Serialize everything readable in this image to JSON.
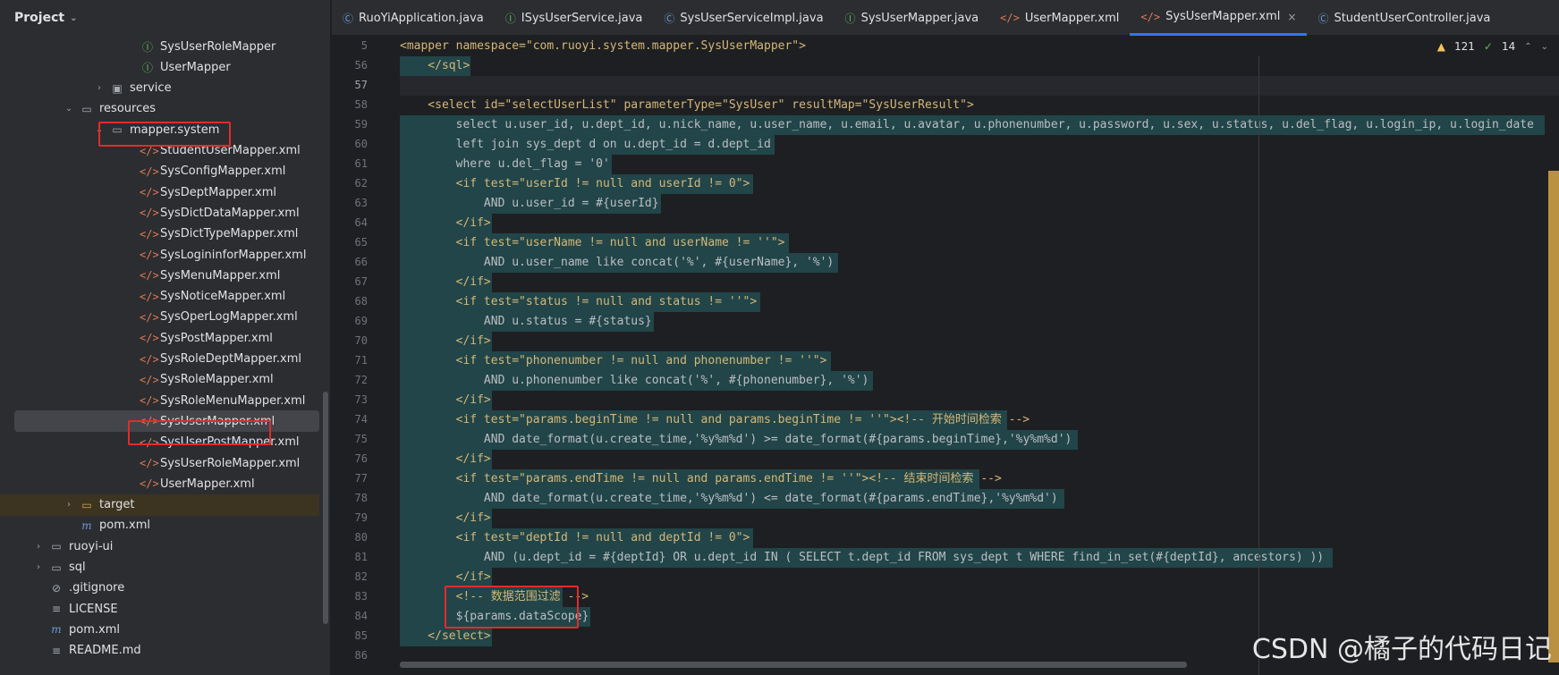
{
  "project": {
    "title": "Project",
    "tree": [
      {
        "label": "SysUserRoleMapper",
        "icon": "interface-icon",
        "indent": 3
      },
      {
        "label": "UserMapper",
        "icon": "interface-icon",
        "indent": 3
      },
      {
        "label": "service",
        "icon": "package-icon",
        "indent": 2,
        "arrow": "›"
      },
      {
        "label": "resources",
        "icon": "folder-icon",
        "indent": 1,
        "arrow": "⌄"
      },
      {
        "label": "mapper.system",
        "icon": "folder-icon",
        "indent": 2,
        "arrow": "⌄"
      },
      {
        "label": "StudentUserMapper.xml",
        "icon": "xml-icon",
        "indent": 3
      },
      {
        "label": "SysConfigMapper.xml",
        "icon": "xml-icon",
        "indent": 3
      },
      {
        "label": "SysDeptMapper.xml",
        "icon": "xml-icon",
        "indent": 3
      },
      {
        "label": "SysDictDataMapper.xml",
        "icon": "xml-icon",
        "indent": 3
      },
      {
        "label": "SysDictTypeMapper.xml",
        "icon": "xml-icon",
        "indent": 3
      },
      {
        "label": "SysLogininforMapper.xml",
        "icon": "xml-icon",
        "indent": 3
      },
      {
        "label": "SysMenuMapper.xml",
        "icon": "xml-icon",
        "indent": 3
      },
      {
        "label": "SysNoticeMapper.xml",
        "icon": "xml-icon",
        "indent": 3
      },
      {
        "label": "SysOperLogMapper.xml",
        "icon": "xml-icon",
        "indent": 3
      },
      {
        "label": "SysPostMapper.xml",
        "icon": "xml-icon",
        "indent": 3
      },
      {
        "label": "SysRoleDeptMapper.xml",
        "icon": "xml-icon",
        "indent": 3
      },
      {
        "label": "SysRoleMapper.xml",
        "icon": "xml-icon",
        "indent": 3
      },
      {
        "label": "SysRoleMenuMapper.xml",
        "icon": "xml-icon",
        "indent": 3
      },
      {
        "label": "SysUserMapper.xml",
        "icon": "xml-icon",
        "indent": 3,
        "selected": true
      },
      {
        "label": "SysUserPostMapper.xml",
        "icon": "xml-icon",
        "indent": 3
      },
      {
        "label": "SysUserRoleMapper.xml",
        "icon": "xml-icon",
        "indent": 3
      },
      {
        "label": "UserMapper.xml",
        "icon": "xml-icon",
        "indent": 3
      },
      {
        "label": "target",
        "icon": "folder-orange-icon",
        "indent": 1,
        "arrow": "›",
        "target": true
      },
      {
        "label": "pom.xml",
        "icon": "maven-icon",
        "indent": 1
      },
      {
        "label": "ruoyi-ui",
        "icon": "folder-icon",
        "indent": 0,
        "arrow": "›"
      },
      {
        "label": "sql",
        "icon": "folder-icon",
        "indent": 0,
        "arrow": "›"
      },
      {
        "label": ".gitignore",
        "icon": "gitignore-icon",
        "indent": 0
      },
      {
        "label": "LICENSE",
        "icon": "text-file-icon",
        "indent": 0
      },
      {
        "label": "pom.xml",
        "icon": "maven-icon",
        "indent": 0
      },
      {
        "label": "README.md",
        "icon": "text-file-icon",
        "indent": 0
      }
    ]
  },
  "tabs": [
    {
      "label": "RuoYiApplication.java",
      "icon": "class-icon"
    },
    {
      "label": "ISysUserService.java",
      "icon": "interface-icon"
    },
    {
      "label": "SysUserServiceImpl.java",
      "icon": "class-icon"
    },
    {
      "label": "SysUserMapper.java",
      "icon": "interface-icon"
    },
    {
      "label": "UserMapper.xml",
      "icon": "xml-icon"
    },
    {
      "label": "SysUserMapper.xml",
      "icon": "xml-icon",
      "active": true
    },
    {
      "label": "StudentUserController.java",
      "icon": "class-icon"
    }
  ],
  "inspections": {
    "warnings": "121",
    "ok": "14"
  },
  "code": [
    {
      "n": "5",
      "text": "<mapper namespace=\"com.ruoyi.system.mapper.SysUserMapper\">"
    },
    {
      "n": "56",
      "text": "    </sql>",
      "sel": true
    },
    {
      "n": "57",
      "text": "",
      "curr": true
    },
    {
      "n": "58",
      "text": "    <select id=\"selectUserList\" parameterType=\"SysUser\" resultMap=\"SysUserResult\">"
    },
    {
      "n": "59",
      "text": "        select u.user_id, u.dept_id, u.nick_name, u.user_name, u.email, u.avatar, u.phonenumber, u.password, u.sex, u.status, u.del_flag, u.login_ip, u.login_date",
      "sel": true
    },
    {
      "n": "60",
      "text": "        left join sys_dept d on u.dept_id = d.dept_id",
      "sel": true
    },
    {
      "n": "61",
      "text": "        where u.del_flag = '0'",
      "sel": true
    },
    {
      "n": "62",
      "text": "        <if test=\"userId != null and userId != 0\">",
      "sel": true
    },
    {
      "n": "63",
      "text": "            AND u.user_id = #{userId}",
      "sel": true
    },
    {
      "n": "64",
      "text": "        </if>",
      "sel": true
    },
    {
      "n": "65",
      "text": "        <if test=\"userName != null and userName != ''\">",
      "sel": true
    },
    {
      "n": "66",
      "text": "            AND u.user_name like concat('%', #{userName}, '%')",
      "sel": true
    },
    {
      "n": "67",
      "text": "        </if>",
      "sel": true
    },
    {
      "n": "68",
      "text": "        <if test=\"status != null and status != ''\">",
      "sel": true
    },
    {
      "n": "69",
      "text": "            AND u.status = #{status}",
      "sel": true
    },
    {
      "n": "70",
      "text": "        </if>",
      "sel": true
    },
    {
      "n": "71",
      "text": "        <if test=\"phonenumber != null and phonenumber != ''\">",
      "sel": true
    },
    {
      "n": "72",
      "text": "            AND u.phonenumber like concat('%', #{phonenumber}, '%')",
      "sel": true
    },
    {
      "n": "73",
      "text": "        </if>",
      "sel": true
    },
    {
      "n": "74",
      "text": "        <if test=\"params.beginTime != null and params.beginTime != ''\"><!-- 开始时间检索 -->",
      "sel": true
    },
    {
      "n": "75",
      "text": "            AND date_format(u.create_time,'%y%m%d') >= date_format(#{params.beginTime},'%y%m%d')",
      "sel": true
    },
    {
      "n": "76",
      "text": "        </if>",
      "sel": true
    },
    {
      "n": "77",
      "text": "        <if test=\"params.endTime != null and params.endTime != ''\"><!-- 结束时间检索 -->",
      "sel": true
    },
    {
      "n": "78",
      "text": "            AND date_format(u.create_time,'%y%m%d') <= date_format(#{params.endTime},'%y%m%d')",
      "sel": true
    },
    {
      "n": "79",
      "text": "        </if>",
      "sel": true
    },
    {
      "n": "80",
      "text": "        <if test=\"deptId != null and deptId != 0\">",
      "sel": true
    },
    {
      "n": "81",
      "text": "            AND (u.dept_id = #{deptId} OR u.dept_id IN ( SELECT t.dept_id FROM sys_dept t WHERE find_in_set(#{deptId}, ancestors) ))",
      "sel": true
    },
    {
      "n": "82",
      "text": "        </if>",
      "sel": true
    },
    {
      "n": "83",
      "text": "        <!-- 数据范围过滤 -->",
      "sel": true
    },
    {
      "n": "84",
      "text": "        ${params.dataScope}",
      "sel": true
    },
    {
      "n": "85",
      "text": "    </select>",
      "sel": true
    },
    {
      "n": "86",
      "text": ""
    }
  ],
  "watermark": "CSDN @橘子的代码日记"
}
